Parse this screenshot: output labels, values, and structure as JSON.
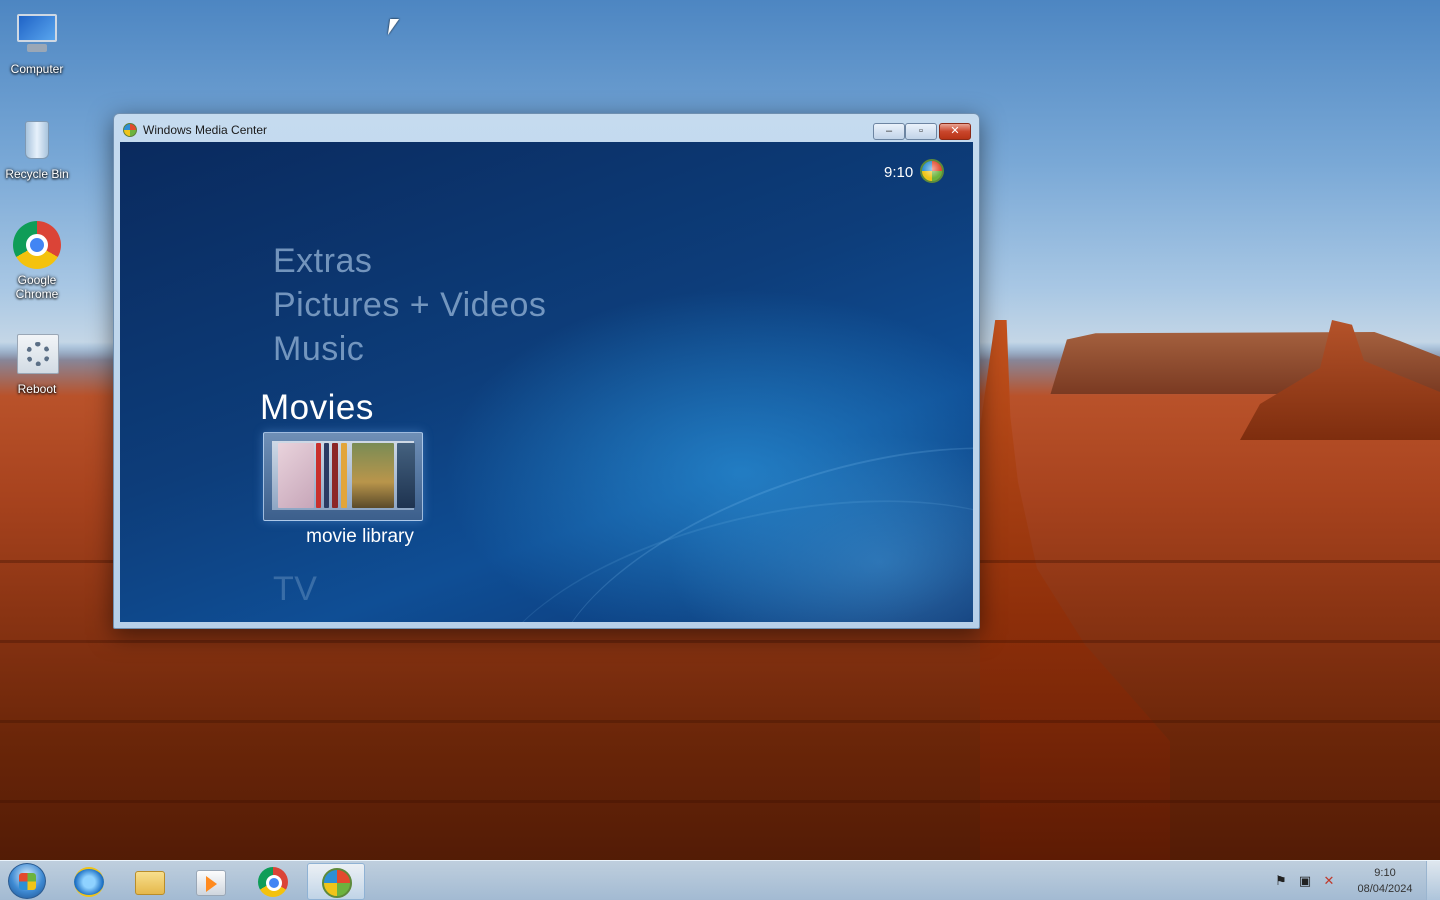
{
  "desktop": {
    "icons": [
      {
        "label": "Computer"
      },
      {
        "label": "Recycle Bin"
      },
      {
        "label": "Google Chrome"
      },
      {
        "label": "Reboot"
      }
    ]
  },
  "window": {
    "title": "Windows Media Center",
    "minimize_label": "–",
    "maximize_label": "▫",
    "close_label": "✕"
  },
  "media_center": {
    "clock": "9:10",
    "menu": [
      {
        "label": "Extras"
      },
      {
        "label": "Pictures + Videos"
      },
      {
        "label": "Music"
      },
      {
        "label": "Movies"
      },
      {
        "label": "TV"
      }
    ],
    "selected_tile_label": "movie library"
  },
  "taskbar": {
    "pinned": [
      "internet-explorer",
      "windows-explorer",
      "windows-media-player",
      "google-chrome",
      "windows-media-center"
    ],
    "clock_time": "9:10",
    "clock_date": "08/04/2024"
  },
  "colors": {
    "wmc_background": "#0d3d7a",
    "close_button": "#c9462c",
    "taskbar": "#c8def0"
  }
}
